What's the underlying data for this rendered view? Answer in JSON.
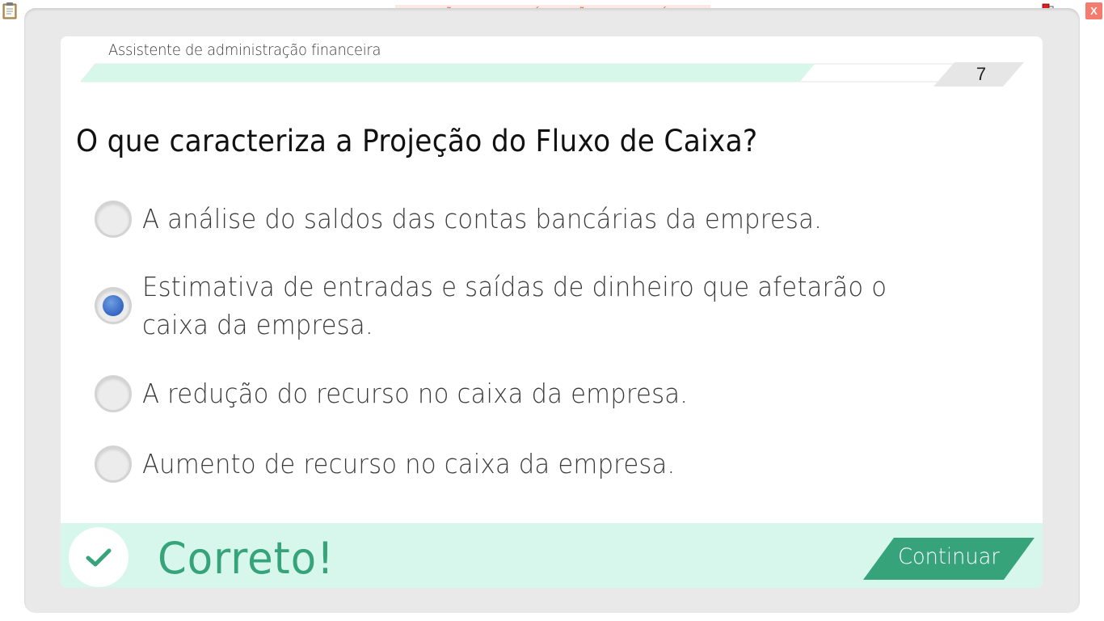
{
  "window": {
    "watermark": "VERSÃO PARA FUNCIONÁRIOS - NÃO COMERCIALIZÁVEL",
    "close_label": "X",
    "icons": {
      "left": "clipboard-icon",
      "right": "network-status-icon"
    }
  },
  "header": {
    "course_title": "Assistente de administração financeira",
    "page_number": "7",
    "progress_fraction": 0.83
  },
  "question": {
    "text": "O que caracteriza a Projeção do Fluxo de Caixa?"
  },
  "options": [
    {
      "text": "A análise do saldos das contas bancárias da empresa.",
      "selected": false
    },
    {
      "text": "Estimativa  de entradas e saídas de dinheiro que afetarão o caixa da empresa.",
      "selected": true
    },
    {
      "text": "A redução do recurso no caixa da empresa.",
      "selected": false
    },
    {
      "text": "Aumento de recurso no caixa da empresa.",
      "selected": false
    }
  ],
  "feedback": {
    "status_text": "Correto!",
    "icon": "checkmark-icon",
    "continue_label": "Continuar"
  },
  "colors": {
    "accent_green": "#36a37b",
    "feedback_bg": "#d7f7ec",
    "progress_fill": "#d6f7ea",
    "radio_selected": "#3566c4",
    "watermark_text": "#e8604a",
    "close_bg": "#f47b6d"
  }
}
